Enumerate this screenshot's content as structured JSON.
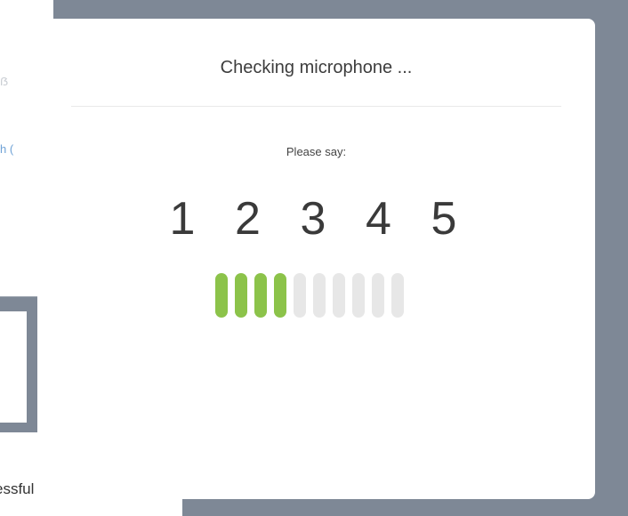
{
  "background": {
    "link_fragment": "h (",
    "glyph_fragment": "ẞ"
  },
  "toast": {
    "message_fragment": "essful",
    "close_glyph": "✕"
  },
  "dialog": {
    "title": "Checking microphone ...",
    "prompt": "Please say:",
    "digits": [
      "1",
      "2",
      "3",
      "4",
      "5"
    ]
  },
  "level_meter": {
    "total_bars": 10,
    "active_bars": 4,
    "level_fraction": 0.4,
    "active_color": "#8cc34a",
    "inactive_color": "#e7e7e7"
  }
}
